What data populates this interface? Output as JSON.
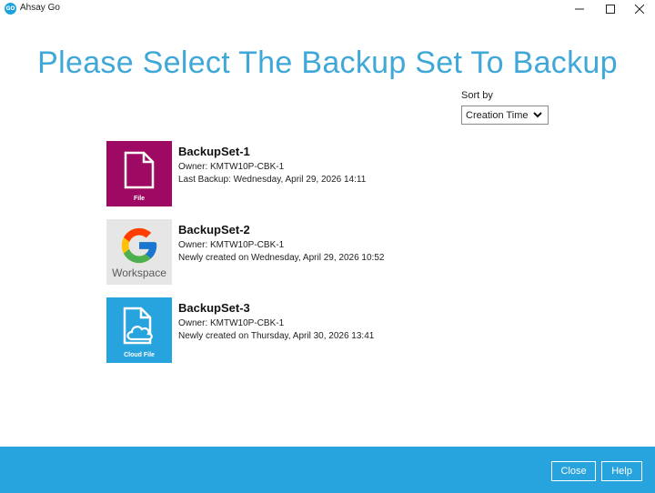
{
  "window": {
    "app_icon_text": "GO",
    "title": "Ahsay Go"
  },
  "header": {
    "title": "Please Select The Backup Set To Backup"
  },
  "sort": {
    "label": "Sort by",
    "selected": "Creation Time"
  },
  "backup_sets": [
    {
      "name": "BackupSet-1",
      "owner": "Owner: KMTW10P-CBK-1",
      "status": "Last Backup: Wednesday, April 29, 2026 14:11",
      "type_label": "File",
      "icon": "file-icon",
      "color": "#9e0a63"
    },
    {
      "name": "BackupSet-2",
      "owner": "Owner: KMTW10P-CBK-1",
      "status": "Newly created on Wednesday, April 29, 2026 10:52",
      "type_label": "Workspace",
      "icon": "google-workspace-icon",
      "color": "#e6e6e6"
    },
    {
      "name": "BackupSet-3",
      "owner": "Owner: KMTW10P-CBK-1",
      "status": "Newly created on Thursday, April 30, 2026 13:41",
      "type_label": "Cloud File",
      "icon": "cloud-file-icon",
      "color": "#27a3de"
    }
  ],
  "footer": {
    "close_label": "Close",
    "help_label": "Help",
    "background": "#27a3de"
  },
  "colors": {
    "accent": "#3fa8d8"
  }
}
